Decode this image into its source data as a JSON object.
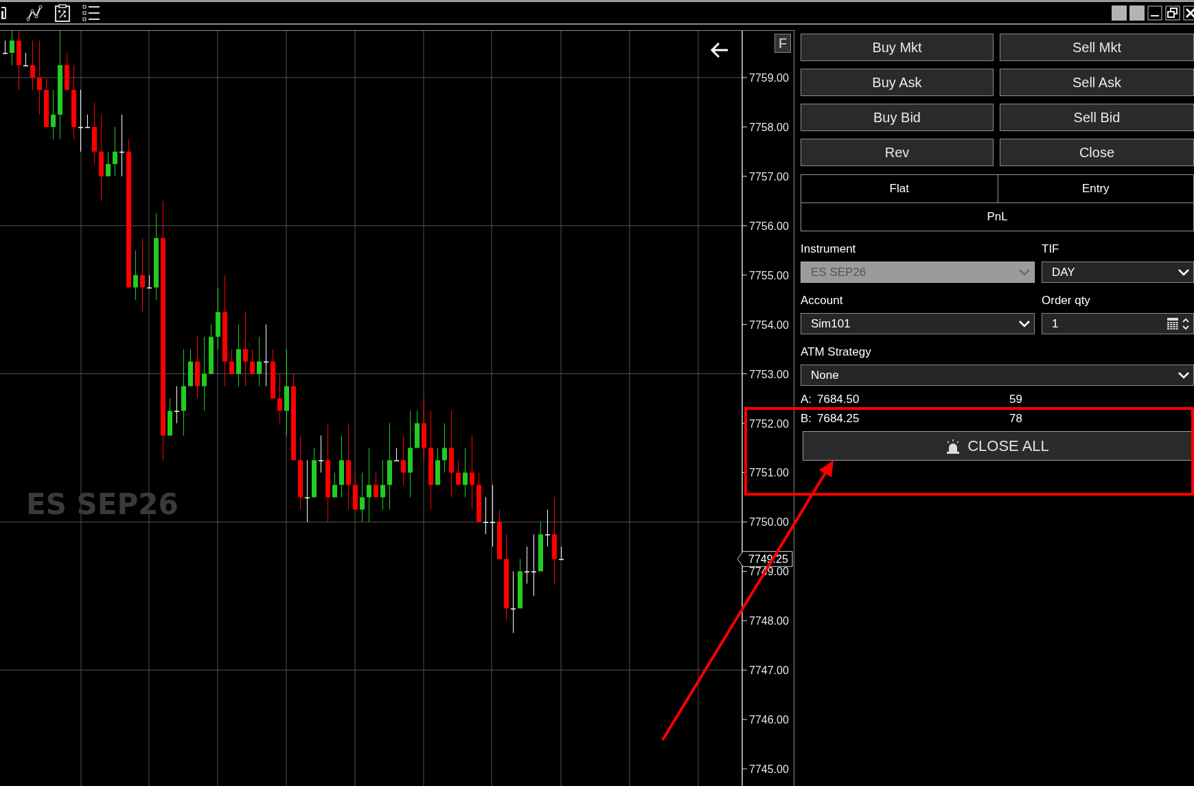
{
  "chart": {
    "watermark": "ES SEP26",
    "f_button": "F",
    "price_axis": [
      "7759.00",
      "7758.00",
      "7757.00",
      "7756.00",
      "7755.00",
      "7754.00",
      "7753.00",
      "7752.00",
      "7751.00",
      "7750.00",
      "7749.00",
      "7748.00",
      "7747.00",
      "7746.00",
      "7745.00"
    ],
    "last_price": "7749.25"
  },
  "order_panel": {
    "buttons": [
      {
        "label": "Buy Mkt"
      },
      {
        "label": "Sell Mkt"
      },
      {
        "label": "Buy Ask"
      },
      {
        "label": "Sell Ask"
      },
      {
        "label": "Buy Bid"
      },
      {
        "label": "Sell Bid"
      },
      {
        "label": "Rev"
      },
      {
        "label": "Close"
      }
    ],
    "position": {
      "columns": [
        "Flat",
        "Entry"
      ],
      "pnl": "PnL"
    },
    "field_rows": [
      [
        {
          "label": "Instrument",
          "value": "ES SEP26",
          "kind": "select",
          "disabled": true
        },
        {
          "label": "TIF",
          "value": "DAY",
          "kind": "select",
          "disabled": false
        }
      ],
      [
        {
          "label": "Account",
          "value": "Sim101",
          "kind": "select",
          "disabled": false
        },
        {
          "label": "Order qty",
          "value": "1",
          "kind": "spinner",
          "disabled": false
        }
      ],
      [
        {
          "label": "ATM Strategy",
          "value": "None",
          "kind": "select",
          "disabled": false
        }
      ]
    ],
    "quotes": [
      {
        "side": "A:",
        "price": "7684.50",
        "size": "59"
      },
      {
        "side": "B:",
        "price": "7684.25",
        "size": "78"
      }
    ],
    "close_all": "CLOSE ALL"
  }
}
